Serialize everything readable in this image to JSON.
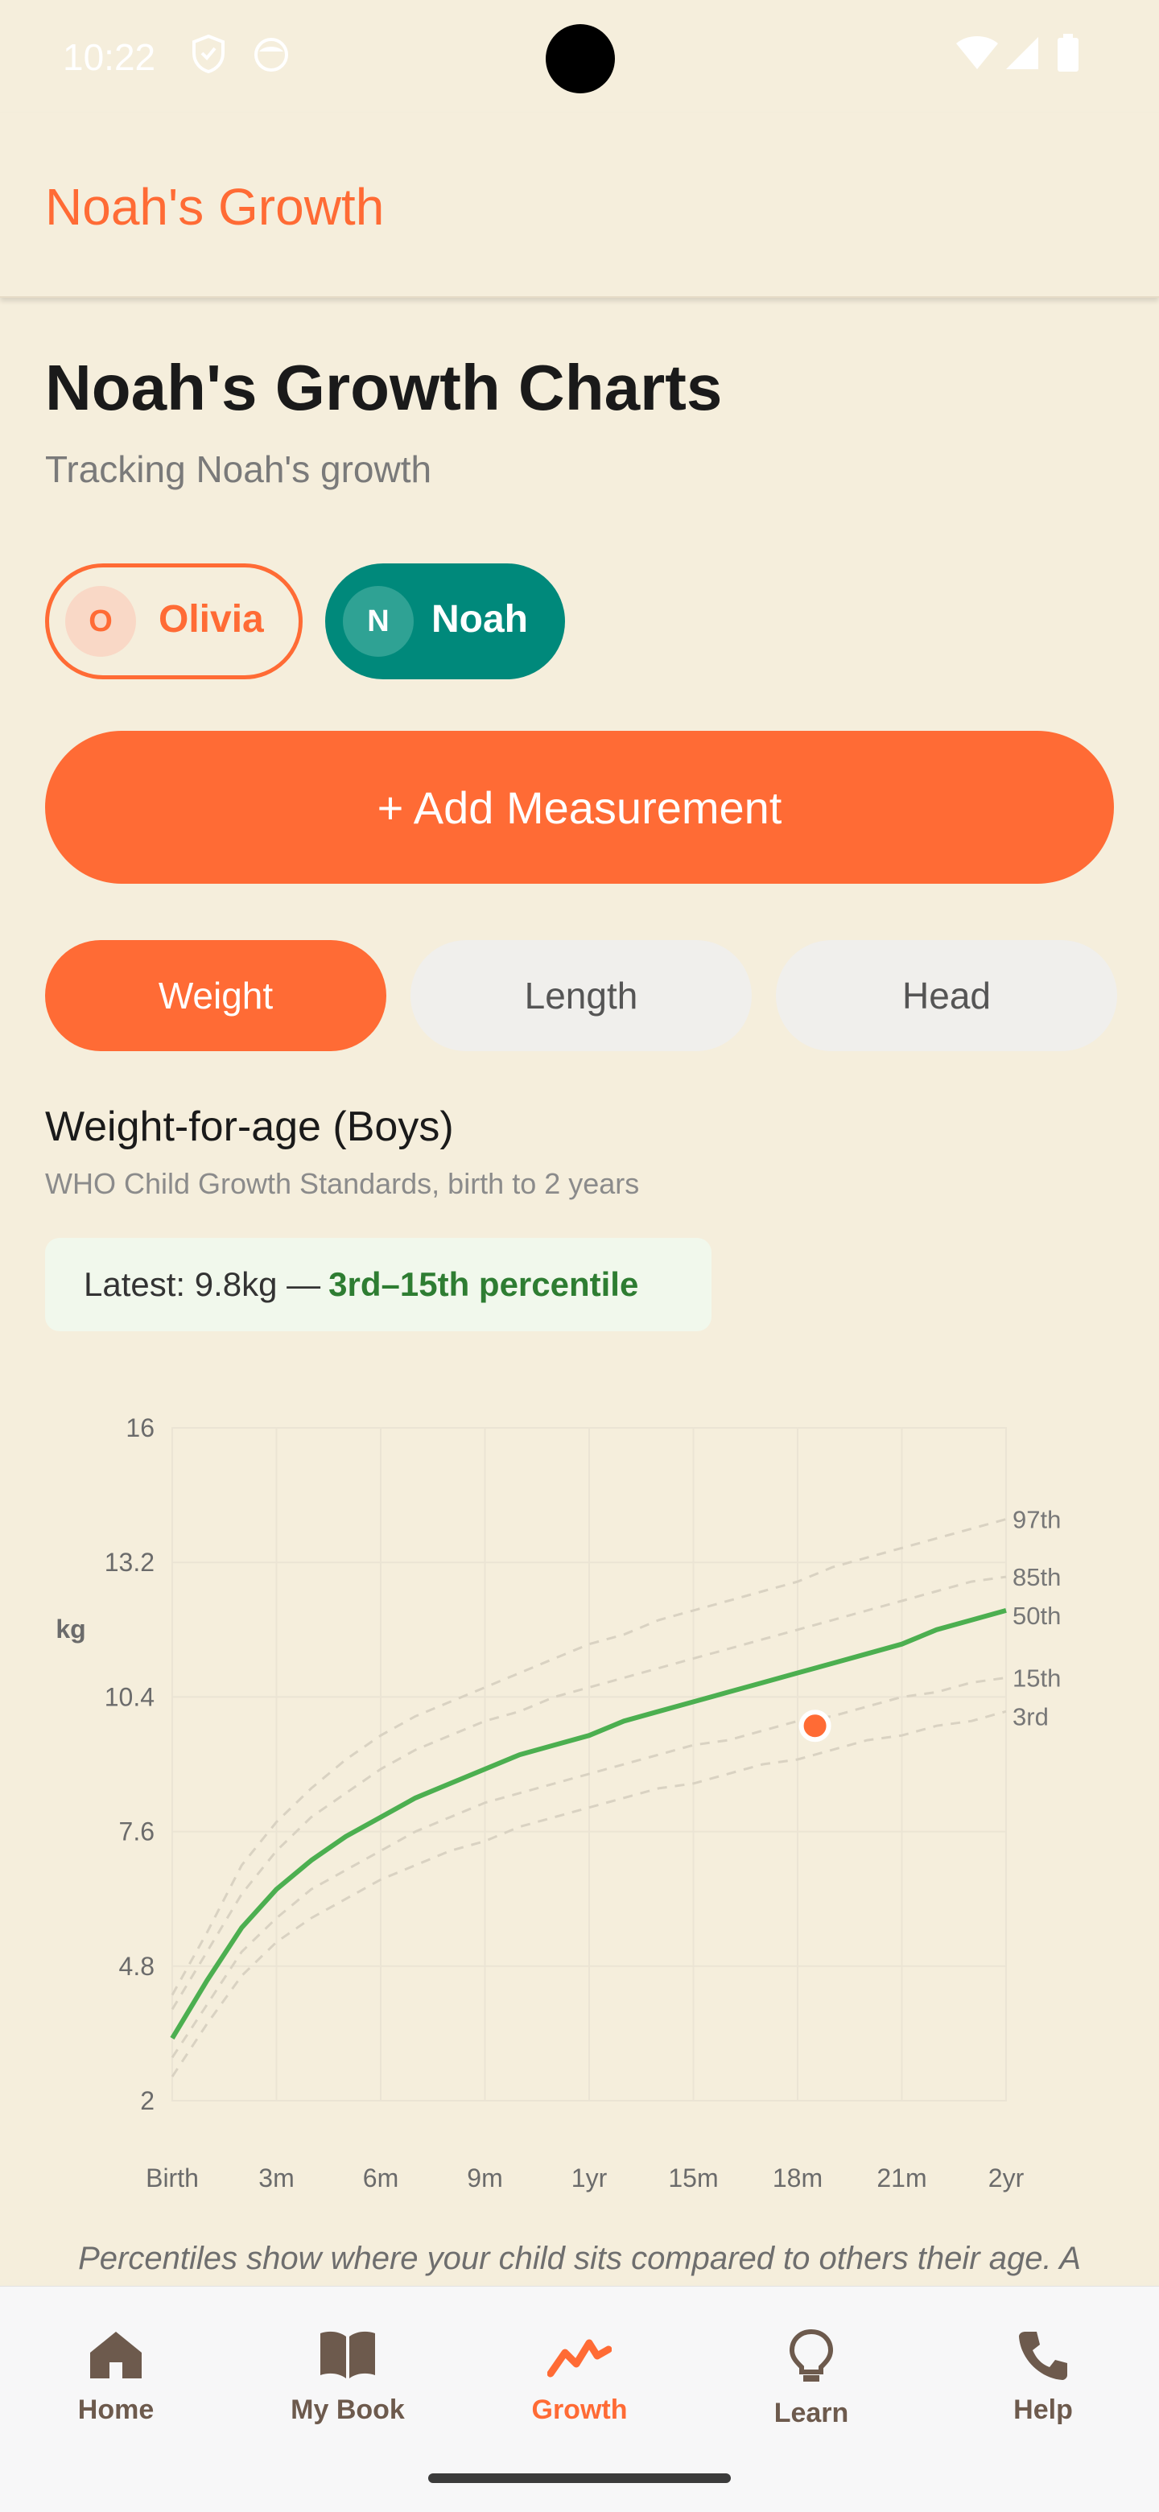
{
  "status": {
    "time": "10:22"
  },
  "app_bar": {
    "title": "Noah's Growth"
  },
  "page": {
    "title": "Noah's Growth Charts",
    "subtitle": "Tracking Noah's growth"
  },
  "children": [
    {
      "initial": "O",
      "name": "Olivia",
      "selected": false
    },
    {
      "initial": "N",
      "name": "Noah",
      "selected": true
    }
  ],
  "add_button": {
    "label": "+ Add Measurement"
  },
  "tabs": [
    {
      "label": "Weight",
      "active": true
    },
    {
      "label": "Length",
      "active": false
    },
    {
      "label": "Head",
      "active": false
    }
  ],
  "chart_section": {
    "title": "Weight-for-age (Boys)",
    "subtitle": "WHO Child Growth Standards, birth to 2 years",
    "latest_prefix": "Latest: 9.8kg —",
    "latest_percentile": "3rd–15th percentile"
  },
  "chart_data": {
    "type": "line",
    "ylabel": "kg",
    "ylim": [
      2,
      16
    ],
    "yticks": [
      "16",
      "13.2",
      "10.4",
      "7.6",
      "4.8",
      "2"
    ],
    "x_ticks": [
      "Birth",
      "3m",
      "6m",
      "9m",
      "1yr",
      "15m",
      "18m",
      "21m",
      "2yr"
    ],
    "x_months": [
      0,
      1,
      2,
      3,
      4,
      5,
      6,
      7,
      8,
      9,
      10,
      11,
      12,
      13,
      14,
      15,
      16,
      17,
      18,
      19,
      20,
      21,
      22,
      23,
      24
    ],
    "series": [
      {
        "name": "97th",
        "values": [
          4.2,
          5.5,
          6.9,
          7.8,
          8.5,
          9.1,
          9.6,
          10.0,
          10.3,
          10.6,
          10.9,
          11.2,
          11.5,
          11.7,
          12.0,
          12.2,
          12.4,
          12.6,
          12.8,
          13.1,
          13.3,
          13.5,
          13.7,
          13.9,
          14.1
        ],
        "dashed": true
      },
      {
        "name": "85th",
        "values": [
          3.9,
          5.1,
          6.3,
          7.2,
          7.9,
          8.4,
          8.9,
          9.3,
          9.6,
          9.9,
          10.1,
          10.4,
          10.6,
          10.8,
          11.0,
          11.2,
          11.4,
          11.6,
          11.8,
          12.0,
          12.2,
          12.4,
          12.6,
          12.8,
          12.9
        ],
        "dashed": true
      },
      {
        "name": "50th",
        "values": [
          3.3,
          4.5,
          5.6,
          6.4,
          7.0,
          7.5,
          7.9,
          8.3,
          8.6,
          8.9,
          9.2,
          9.4,
          9.6,
          9.9,
          10.1,
          10.3,
          10.5,
          10.7,
          10.9,
          11.1,
          11.3,
          11.5,
          11.8,
          12.0,
          12.2
        ],
        "dashed": false
      },
      {
        "name": "15th",
        "values": [
          2.9,
          4.0,
          5.1,
          5.8,
          6.4,
          6.8,
          7.2,
          7.6,
          7.9,
          8.2,
          8.4,
          8.6,
          8.8,
          9.0,
          9.2,
          9.4,
          9.5,
          9.7,
          9.9,
          10.0,
          10.2,
          10.4,
          10.5,
          10.7,
          10.8
        ],
        "dashed": true
      },
      {
        "name": "3rd",
        "values": [
          2.5,
          3.6,
          4.6,
          5.3,
          5.8,
          6.2,
          6.6,
          6.9,
          7.2,
          7.4,
          7.7,
          7.9,
          8.1,
          8.3,
          8.5,
          8.6,
          8.8,
          9.0,
          9.1,
          9.3,
          9.5,
          9.6,
          9.8,
          9.9,
          10.1
        ],
        "dashed": true
      }
    ],
    "measurements": [
      {
        "x": 18.5,
        "y": 9.8
      }
    ],
    "grid": true,
    "colors": {
      "median": "#4CAF50",
      "percentile": "#d9d2c2",
      "point": "#FF6B35"
    }
  },
  "note": "Percentiles show where your child sits compared to others their age. A",
  "nav": [
    {
      "label": "Home",
      "icon": "home-icon",
      "active": false
    },
    {
      "label": "My Book",
      "icon": "book-icon",
      "active": false
    },
    {
      "label": "Growth",
      "icon": "growth-chart-icon",
      "active": true
    },
    {
      "label": "Learn",
      "icon": "lightbulb-icon",
      "active": false
    },
    {
      "label": "Help",
      "icon": "phone-icon",
      "active": false
    }
  ],
  "colors": {
    "accent": "#FF6B35",
    "teal": "#00897B",
    "background": "#F5EEDC",
    "green": "#2E7D32"
  }
}
